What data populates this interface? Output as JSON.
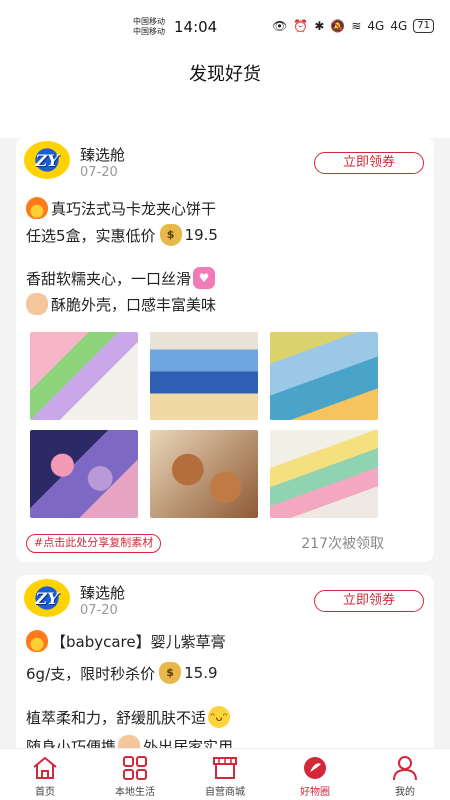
{
  "status_bar": {
    "carrier1": "中国移动",
    "carrier2": "中国移动",
    "time": "14:04",
    "signal1": "4G",
    "signal2": "4G",
    "battery": "71"
  },
  "header": {
    "title": "发现好货"
  },
  "posts": [
    {
      "shop": "臻选舱",
      "date": "07-20",
      "coupon_label": "立即领券",
      "title_line": "真巧法式马卡龙夹心饼干",
      "price_prefix": "任选5盒，实惠低价",
      "price": "19.5",
      "desc1": "香甜软糯夹心，一口丝滑",
      "desc2": "酥脆外壳，口感丰富美味",
      "copy_label": "#点击此处分享复制素材",
      "claim_count": "217次被领取"
    },
    {
      "shop": "臻选舱",
      "date": "07-20",
      "coupon_label": "立即领券",
      "title_line": "【babycare】婴儿紫草膏",
      "price_prefix": "6g/支，限时秒杀价",
      "price": "15.9",
      "desc1": "植萃柔和力，舒缓肌肤不适",
      "desc2": "随身小巧便携",
      "desc2_tail": "外出居家实用"
    }
  ],
  "logo_text": "ZY",
  "tabs": [
    {
      "label": "首页",
      "icon": "home-icon"
    },
    {
      "label": "本地生活",
      "icon": "grid-icon"
    },
    {
      "label": "自营商城",
      "icon": "store-icon"
    },
    {
      "label": "好物圈",
      "icon": "goods-circle-icon",
      "active": true
    },
    {
      "label": "我的",
      "icon": "profile-icon"
    }
  ],
  "colors": {
    "accent": "#d4283a",
    "background": "#f4f4f4"
  }
}
